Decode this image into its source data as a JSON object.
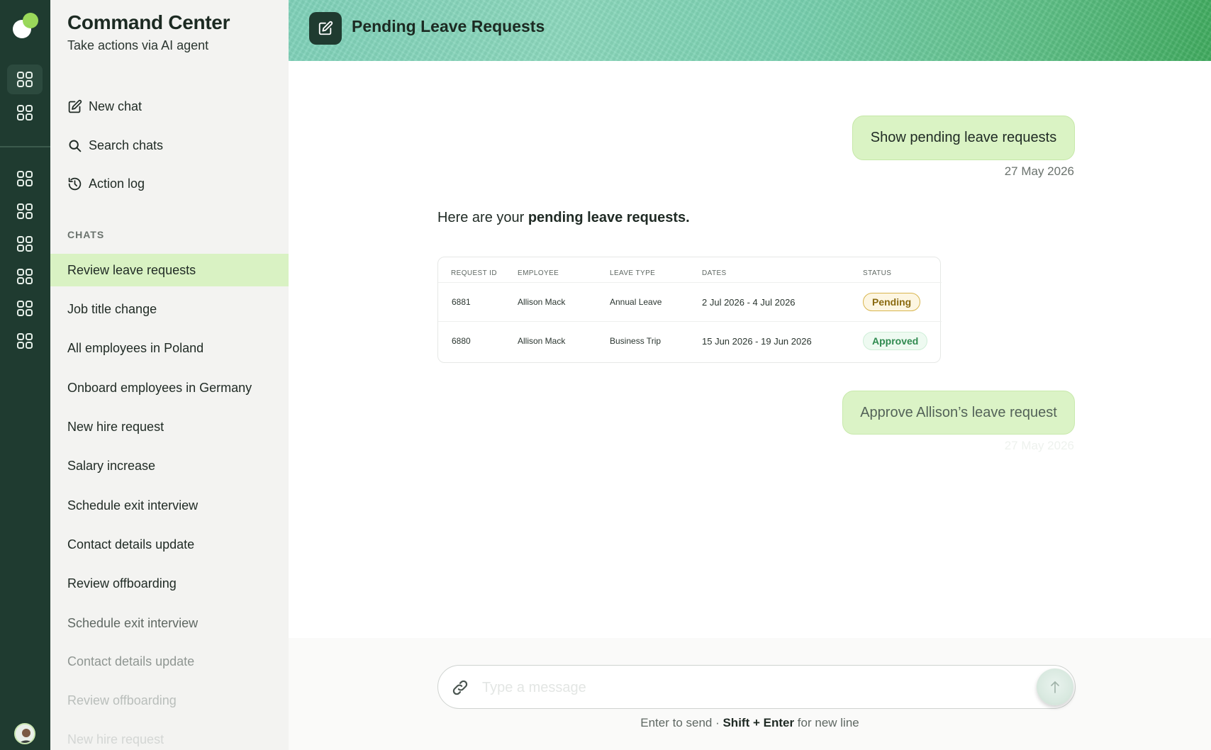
{
  "brand": {
    "title": "Command Center",
    "subtitle": "Take actions via AI agent"
  },
  "rail": {
    "icons": [
      "grid-icon",
      "grid-icon",
      "grid-icon",
      "grid-icon",
      "grid-icon",
      "grid-icon",
      "grid-icon",
      "grid-icon"
    ]
  },
  "nav": {
    "new_chat": "New chat",
    "search_chats": "Search chats",
    "action_log": "Action log"
  },
  "chats": {
    "section_label": "CHATS",
    "items": [
      {
        "label": "Review leave requests",
        "active": true
      },
      {
        "label": "Job title change"
      },
      {
        "label": "All employees in Poland"
      },
      {
        "label": "Onboard employees in Germany"
      },
      {
        "label": "New hire request"
      },
      {
        "label": "Salary increase"
      },
      {
        "label": "Schedule exit interview"
      },
      {
        "label": "Contact details update"
      },
      {
        "label": "Review offboarding"
      },
      {
        "label": "Schedule exit interview"
      },
      {
        "label": "Contact details update"
      },
      {
        "label": "Review offboarding"
      },
      {
        "label": "New hire request"
      }
    ]
  },
  "header": {
    "title": "Pending Leave Requests"
  },
  "conversation": {
    "user_message_1": "Show pending leave requests",
    "timestamp_1": "27 May 2026",
    "assistant_prefix": "Here are your ",
    "assistant_bold": "pending leave requests.",
    "user_message_2": "Approve Allison’s leave request",
    "timestamp_2": "27 May 2026"
  },
  "table": {
    "columns": [
      "REQUEST ID",
      "EMPLOYEE",
      "LEAVE TYPE",
      "DATES",
      "STATUS"
    ],
    "rows": [
      {
        "id": "6881",
        "employee": "Allison Mack",
        "leave_type": "Annual Leave",
        "dates": "2 Jul 2026 - 4 Jul 2026",
        "status": "Pending"
      },
      {
        "id": "6880",
        "employee": "Allison Mack",
        "leave_type": "Business Trip",
        "dates": "15 Jun 2026 - 19 Jun 2026",
        "status": "Approved"
      }
    ]
  },
  "composer": {
    "placeholder": "Type a message",
    "hint_1": "Enter to send · ",
    "hint_shift_enter": "Shift + Enter",
    "hint_2": " for new line"
  },
  "colors": {
    "rail_bg": "#1f3b30",
    "active_chat_bg": "#d9f2c3",
    "user_bubble_bg": "#daf3c4",
    "pending_color": "#d8b54e",
    "approved_color": "#2f8a4f"
  }
}
